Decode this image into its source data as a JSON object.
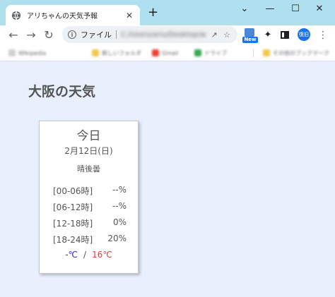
{
  "browser": {
    "tab_title": "アリちゃんの天気予報",
    "tab_close": "✕",
    "new_tab": "+",
    "window_controls": {
      "chevron": "⌄",
      "minimize": "—",
      "maximize": "☐",
      "close": "✕"
    },
    "omnibox": {
      "scheme": "ファイル",
      "url": "C:/Users/ariu/Desktop/weather/index.html"
    },
    "extension_badge": "New",
    "profile_label": "復旧"
  },
  "bookmarks": [
    {
      "label": "Wikipedia",
      "color": "#d0d0d0"
    },
    {
      "label": "新しいフォルダ",
      "color": "#f4c74a"
    },
    {
      "label": "Gmail",
      "color": "#ea4335"
    },
    {
      "label": "ドライブ",
      "color": "#34a853"
    },
    {
      "label": "その他のブックマーク",
      "color": "#f4c74a"
    }
  ],
  "page": {
    "heading": "大阪の天気",
    "forecast": {
      "day": "今日",
      "date": "2月12日(日)",
      "weather": "晴後曇",
      "rain_chance": [
        {
          "period": "[00-06時]",
          "value": "--%"
        },
        {
          "period": "[06-12時]",
          "value": "--%"
        },
        {
          "period": "[12-18時]",
          "value": "0%"
        },
        {
          "period": "[18-24時]",
          "value": "20%"
        }
      ],
      "temp_min": "-℃",
      "temp_sep": "/",
      "temp_max": "16℃"
    }
  },
  "colors": {
    "tab_strip": "#aee0ef",
    "page_bg": "#e8f0fe",
    "temp_min": "#2a2ad0",
    "temp_max": "#e53935"
  }
}
